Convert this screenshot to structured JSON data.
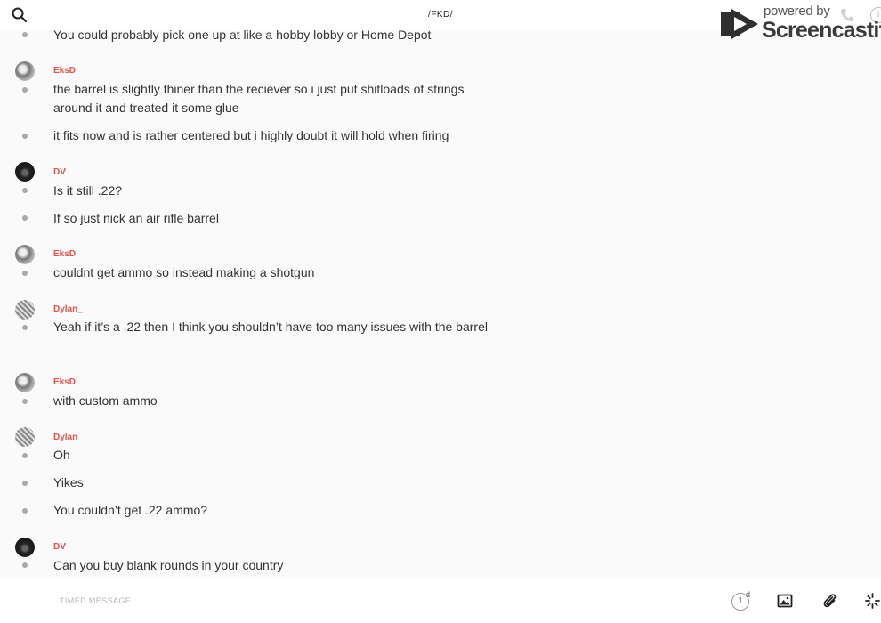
{
  "header": {
    "title": "/FKD/",
    "search_icon": "search-icon",
    "phone_icon": "phone-icon",
    "info_label": "i"
  },
  "watermark": {
    "powered": "powered by",
    "brand": "Screencastify"
  },
  "messages": [
    {
      "text": "You could probably pick one up at like a hobby lobby or Home Depot"
    },
    {
      "author": "EksD",
      "text": "the barrel is slightly thiner than the reciever so i just put shitloads of strings around it and treated it some glue"
    },
    {
      "text": "it fits now and is rather centered but i highly doubt it will hold when firing"
    },
    {
      "author": "DV",
      "text": "Is it still .22?"
    },
    {
      "text": "If so just nick an air rifle barrel"
    },
    {
      "author": "EksD",
      "text": "couldnt get ammo so instead making a shotgun"
    },
    {
      "author": "Dylan_",
      "text": "Yeah if it’s a .22 then I think you shouldn’t have too many issues with the barrel"
    },
    {
      "author": "EksD",
      "text": "with custom ammo"
    },
    {
      "author": "Dylan_",
      "text": "Oh"
    },
    {
      "text": "Yikes"
    },
    {
      "text": "You couldn’t get .22 ammo?"
    },
    {
      "author": "DV",
      "text": "Can you buy blank rounds in your country"
    }
  ],
  "composer": {
    "placeholder": "TIMED MESSAGE",
    "timer_value": "1",
    "timer_unit": "d"
  },
  "colors": {
    "author": "#e0544f",
    "background": "#fafafa"
  }
}
